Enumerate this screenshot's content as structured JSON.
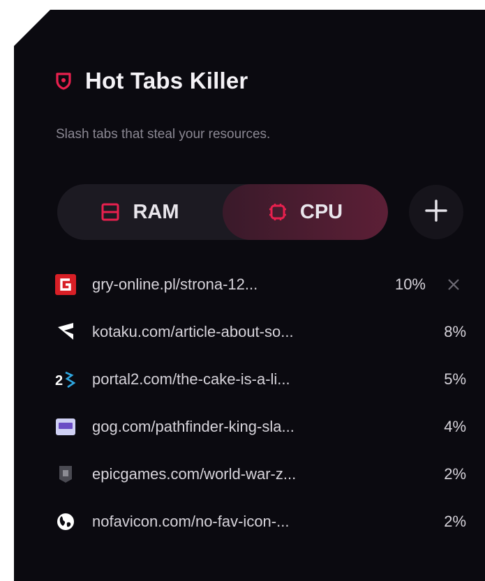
{
  "app": {
    "title": "Hot Tabs Killer",
    "subtitle": "Slash tabs that steal your resources.",
    "accent": "#e8204e"
  },
  "toggle": {
    "options": [
      {
        "label": "RAM",
        "icon": "memory-icon",
        "active": false
      },
      {
        "label": "CPU",
        "icon": "cpu-icon",
        "active": true
      }
    ],
    "add_icon": "plus-icon"
  },
  "tabs": [
    {
      "url": "gry-online.pl/strona-12...",
      "percent": "10%",
      "favicon": "gry-online-favicon",
      "hovered": true
    },
    {
      "url": "kotaku.com/article-about-so...",
      "percent": "8%",
      "favicon": "kotaku-favicon",
      "hovered": false
    },
    {
      "url": "portal2.com/the-cake-is-a-li...",
      "percent": "5%",
      "favicon": "portal2-favicon",
      "hovered": false
    },
    {
      "url": "gog.com/pathfinder-king-sla...",
      "percent": "4%",
      "favicon": "gog-favicon",
      "hovered": false
    },
    {
      "url": "epicgames.com/world-war-z...",
      "percent": "2%",
      "favicon": "epicgames-favicon",
      "hovered": false
    },
    {
      "url": "nofavicon.com/no-fav-icon-...",
      "percent": "2%",
      "favicon": "globe-icon",
      "hovered": false
    }
  ]
}
